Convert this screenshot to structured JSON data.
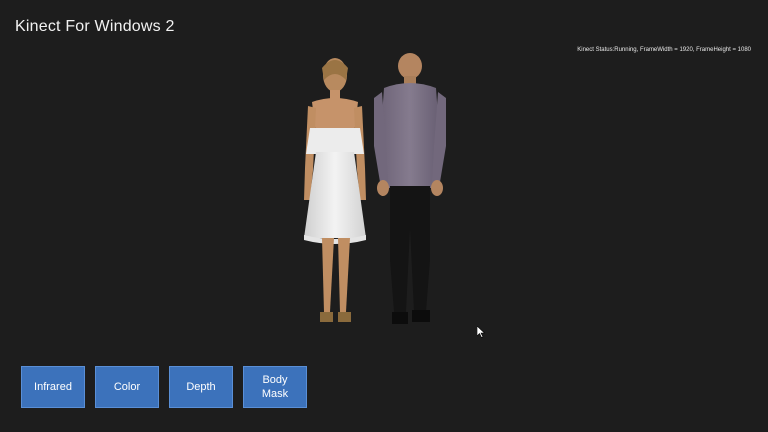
{
  "app": {
    "title": "Kinect For Windows 2"
  },
  "status": {
    "text": "Kinect Status:Running, FrameWidth = 1920, FrameHeight = 1080"
  },
  "buttons": [
    {
      "label": "Infrared"
    },
    {
      "label": "Color"
    },
    {
      "label": "Depth"
    },
    {
      "label": "Body\nMask"
    }
  ],
  "colors": {
    "background": "#1d1d1d",
    "button_fill": "#3c72bb",
    "button_border": "#5a8fd6",
    "text": "#ffffff"
  }
}
